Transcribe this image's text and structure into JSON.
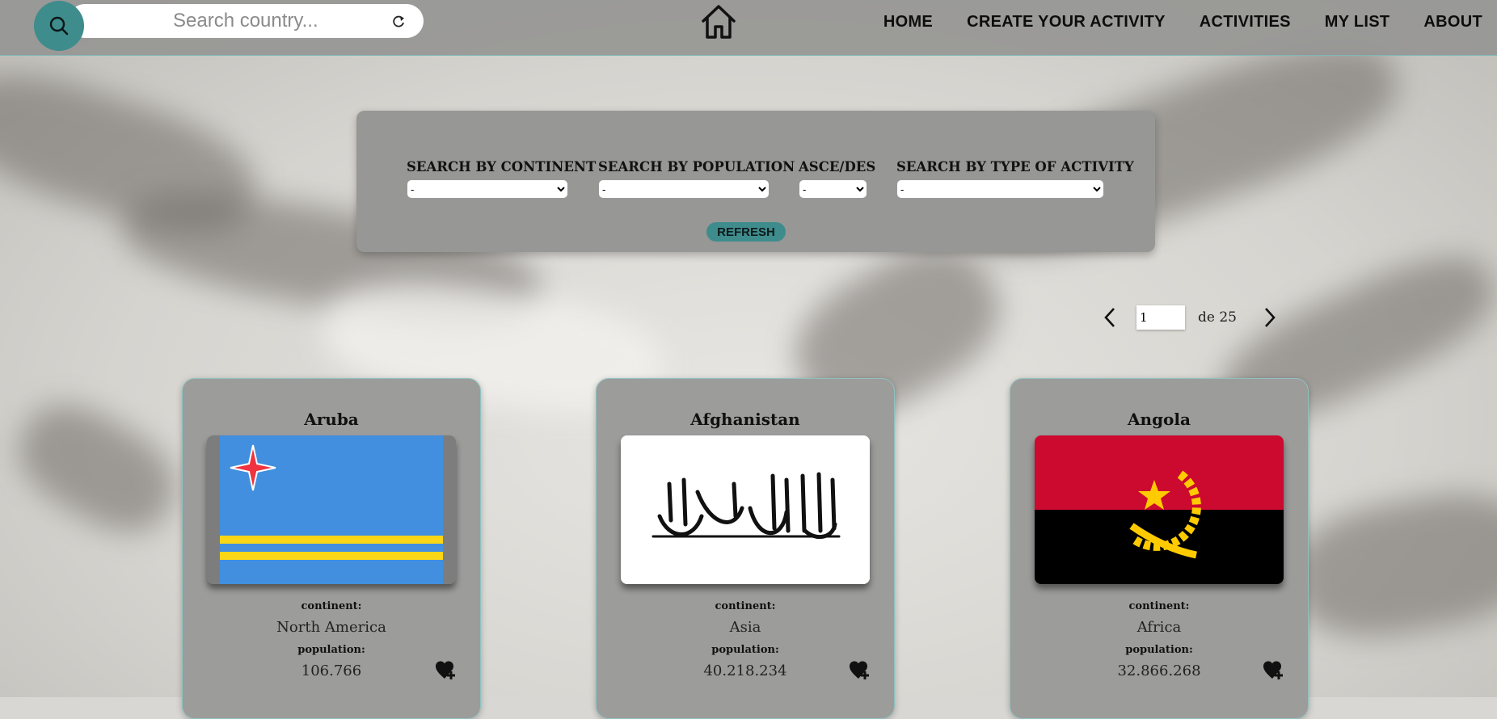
{
  "search": {
    "placeholder": "Search country..."
  },
  "nav": {
    "home": "HOME",
    "create": "CREATE YOUR ACTIVITY",
    "activities": "ACTIVITIES",
    "my_list": "MY LIST",
    "about": "ABOUT"
  },
  "filters": {
    "continent_label": "SEARCH BY CONTINENT",
    "continent_value": "-",
    "population_label": "SEARCH BY POPULATION",
    "population_value": "-",
    "order_label": "ASCE/DES",
    "order_value": "-",
    "activity_label": "SEARCH BY TYPE OF ACTIVITY",
    "activity_value": "-",
    "refresh_label": "REFRESH"
  },
  "pagination": {
    "current": "1",
    "total_text": "de 25"
  },
  "cards": [
    {
      "name": "Aruba",
      "continent_label": "continent:",
      "continent": "North America",
      "population_label": "population:",
      "population": "106.766"
    },
    {
      "name": "Afghanistan",
      "continent_label": "continent:",
      "continent": "Asia",
      "population_label": "population:",
      "population": "40.218.234"
    },
    {
      "name": "Angola",
      "continent_label": "continent:",
      "continent": "Africa",
      "population_label": "population:",
      "population": "32.866.268"
    }
  ],
  "colors": {
    "accent": "#3f8c8d",
    "panel": "#979796",
    "nav": "#969694"
  },
  "icons": [
    "search-icon",
    "refresh-icon",
    "home-icon",
    "chevron-left-icon",
    "chevron-right-icon",
    "heart-plus-icon"
  ]
}
